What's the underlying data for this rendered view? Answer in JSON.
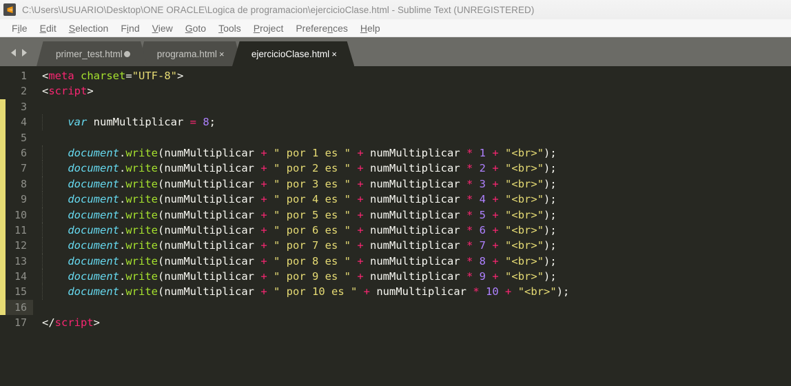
{
  "window": {
    "title": "C:\\Users\\USUARIO\\Desktop\\ONE ORACLE\\Logica de programacion\\ejercicioClase.html - Sublime Text (UNREGISTERED)",
    "logo_icon": "sublime-text-logo-icon"
  },
  "menubar": {
    "items": [
      {
        "label": "File",
        "pre": "F",
        "mn": "i",
        "post": "le"
      },
      {
        "label": "Edit",
        "pre": "",
        "mn": "E",
        "post": "dit"
      },
      {
        "label": "Selection",
        "pre": "",
        "mn": "S",
        "post": "election"
      },
      {
        "label": "Find",
        "pre": "F",
        "mn": "i",
        "post": "nd"
      },
      {
        "label": "View",
        "pre": "",
        "mn": "V",
        "post": "iew"
      },
      {
        "label": "Goto",
        "pre": "",
        "mn": "G",
        "post": "oto"
      },
      {
        "label": "Tools",
        "pre": "",
        "mn": "T",
        "post": "ools"
      },
      {
        "label": "Project",
        "pre": "",
        "mn": "P",
        "post": "roject"
      },
      {
        "label": "Preferences",
        "pre": "Prefere",
        "mn": "n",
        "post": "ces"
      },
      {
        "label": "Help",
        "pre": "",
        "mn": "H",
        "post": "elp"
      }
    ]
  },
  "tabbar": {
    "nav_back_icon": "chevron-left-icon",
    "nav_forward_icon": "chevron-forward-icon",
    "tabs": [
      {
        "label": "primer_test.html",
        "active": false,
        "indicator": "dirty-dot",
        "indicator_glyph": ""
      },
      {
        "label": "programa.html",
        "active": false,
        "indicator": "close-icon",
        "indicator_glyph": "×"
      },
      {
        "label": "ejercicioClase.html",
        "active": true,
        "indicator": "close-icon",
        "indicator_glyph": "×"
      }
    ]
  },
  "editor": {
    "theme": {
      "background": "#272822",
      "gutter_text": "#8f908a",
      "current_line_gutter": "#3a3a32",
      "modified_marker": "#e6db74",
      "plain": "#f8f8f2",
      "tag": "#f92672",
      "attribute": "#a6e22e",
      "string": "#e6db74",
      "keyword": "#66d9ef",
      "number": "#ae81ff",
      "operator": "#f92672"
    },
    "cursor_line": 16,
    "modified_lines": [
      3,
      16
    ],
    "lines": [
      {
        "n": 1,
        "indent": false,
        "tokens": [
          {
            "t": "plain",
            "v": "<"
          },
          {
            "t": "tag",
            "v": "meta"
          },
          {
            "t": "plain",
            "v": " "
          },
          {
            "t": "attr",
            "v": "charset"
          },
          {
            "t": "plain",
            "v": "="
          },
          {
            "t": "str",
            "v": "\"UTF-8\""
          },
          {
            "t": "plain",
            "v": ">"
          }
        ]
      },
      {
        "n": 2,
        "indent": false,
        "tokens": [
          {
            "t": "plain",
            "v": "<"
          },
          {
            "t": "tag",
            "v": "script"
          },
          {
            "t": "plain",
            "v": ">"
          }
        ]
      },
      {
        "n": 3,
        "indent": true,
        "tokens": []
      },
      {
        "n": 4,
        "indent": true,
        "tokens": [
          {
            "t": "plain",
            "v": "    "
          },
          {
            "t": "kw",
            "v": "var"
          },
          {
            "t": "plain",
            "v": " numMultiplicar "
          },
          {
            "t": "op",
            "v": "="
          },
          {
            "t": "plain",
            "v": " "
          },
          {
            "t": "num",
            "v": "8"
          },
          {
            "t": "plain",
            "v": ";"
          }
        ]
      },
      {
        "n": 5,
        "indent": true,
        "tokens": []
      },
      {
        "n": 6,
        "indent": true,
        "tokens": [
          {
            "t": "plain",
            "v": "    "
          },
          {
            "t": "kw",
            "v": "document"
          },
          {
            "t": "plain",
            "v": "."
          },
          {
            "t": "fn",
            "v": "write"
          },
          {
            "t": "plain",
            "v": "(numMultiplicar "
          },
          {
            "t": "op",
            "v": "+"
          },
          {
            "t": "plain",
            "v": " "
          },
          {
            "t": "str",
            "v": "\" por 1 es \""
          },
          {
            "t": "plain",
            "v": " "
          },
          {
            "t": "op",
            "v": "+"
          },
          {
            "t": "plain",
            "v": " numMultiplicar "
          },
          {
            "t": "op",
            "v": "*"
          },
          {
            "t": "plain",
            "v": " "
          },
          {
            "t": "num",
            "v": "1"
          },
          {
            "t": "plain",
            "v": " "
          },
          {
            "t": "op",
            "v": "+"
          },
          {
            "t": "plain",
            "v": " "
          },
          {
            "t": "str",
            "v": "\"<br>\""
          },
          {
            "t": "plain",
            "v": ");"
          }
        ]
      },
      {
        "n": 7,
        "indent": true,
        "tokens": [
          {
            "t": "plain",
            "v": "    "
          },
          {
            "t": "kw",
            "v": "document"
          },
          {
            "t": "plain",
            "v": "."
          },
          {
            "t": "fn",
            "v": "write"
          },
          {
            "t": "plain",
            "v": "(numMultiplicar "
          },
          {
            "t": "op",
            "v": "+"
          },
          {
            "t": "plain",
            "v": " "
          },
          {
            "t": "str",
            "v": "\" por 2 es \""
          },
          {
            "t": "plain",
            "v": " "
          },
          {
            "t": "op",
            "v": "+"
          },
          {
            "t": "plain",
            "v": " numMultiplicar "
          },
          {
            "t": "op",
            "v": "*"
          },
          {
            "t": "plain",
            "v": " "
          },
          {
            "t": "num",
            "v": "2"
          },
          {
            "t": "plain",
            "v": " "
          },
          {
            "t": "op",
            "v": "+"
          },
          {
            "t": "plain",
            "v": " "
          },
          {
            "t": "str",
            "v": "\"<br>\""
          },
          {
            "t": "plain",
            "v": ");"
          }
        ]
      },
      {
        "n": 8,
        "indent": true,
        "tokens": [
          {
            "t": "plain",
            "v": "    "
          },
          {
            "t": "kw",
            "v": "document"
          },
          {
            "t": "plain",
            "v": "."
          },
          {
            "t": "fn",
            "v": "write"
          },
          {
            "t": "plain",
            "v": "(numMultiplicar "
          },
          {
            "t": "op",
            "v": "+"
          },
          {
            "t": "plain",
            "v": " "
          },
          {
            "t": "str",
            "v": "\" por 3 es \""
          },
          {
            "t": "plain",
            "v": " "
          },
          {
            "t": "op",
            "v": "+"
          },
          {
            "t": "plain",
            "v": " numMultiplicar "
          },
          {
            "t": "op",
            "v": "*"
          },
          {
            "t": "plain",
            "v": " "
          },
          {
            "t": "num",
            "v": "3"
          },
          {
            "t": "plain",
            "v": " "
          },
          {
            "t": "op",
            "v": "+"
          },
          {
            "t": "plain",
            "v": " "
          },
          {
            "t": "str",
            "v": "\"<br>\""
          },
          {
            "t": "plain",
            "v": ");"
          }
        ]
      },
      {
        "n": 9,
        "indent": true,
        "tokens": [
          {
            "t": "plain",
            "v": "    "
          },
          {
            "t": "kw",
            "v": "document"
          },
          {
            "t": "plain",
            "v": "."
          },
          {
            "t": "fn",
            "v": "write"
          },
          {
            "t": "plain",
            "v": "(numMultiplicar "
          },
          {
            "t": "op",
            "v": "+"
          },
          {
            "t": "plain",
            "v": " "
          },
          {
            "t": "str",
            "v": "\" por 4 es \""
          },
          {
            "t": "plain",
            "v": " "
          },
          {
            "t": "op",
            "v": "+"
          },
          {
            "t": "plain",
            "v": " numMultiplicar "
          },
          {
            "t": "op",
            "v": "*"
          },
          {
            "t": "plain",
            "v": " "
          },
          {
            "t": "num",
            "v": "4"
          },
          {
            "t": "plain",
            "v": " "
          },
          {
            "t": "op",
            "v": "+"
          },
          {
            "t": "plain",
            "v": " "
          },
          {
            "t": "str",
            "v": "\"<br>\""
          },
          {
            "t": "plain",
            "v": ");"
          }
        ]
      },
      {
        "n": 10,
        "indent": true,
        "tokens": [
          {
            "t": "plain",
            "v": "    "
          },
          {
            "t": "kw",
            "v": "document"
          },
          {
            "t": "plain",
            "v": "."
          },
          {
            "t": "fn",
            "v": "write"
          },
          {
            "t": "plain",
            "v": "(numMultiplicar "
          },
          {
            "t": "op",
            "v": "+"
          },
          {
            "t": "plain",
            "v": " "
          },
          {
            "t": "str",
            "v": "\" por 5 es \""
          },
          {
            "t": "plain",
            "v": " "
          },
          {
            "t": "op",
            "v": "+"
          },
          {
            "t": "plain",
            "v": " numMultiplicar "
          },
          {
            "t": "op",
            "v": "*"
          },
          {
            "t": "plain",
            "v": " "
          },
          {
            "t": "num",
            "v": "5"
          },
          {
            "t": "plain",
            "v": " "
          },
          {
            "t": "op",
            "v": "+"
          },
          {
            "t": "plain",
            "v": " "
          },
          {
            "t": "str",
            "v": "\"<br>\""
          },
          {
            "t": "plain",
            "v": ");"
          }
        ]
      },
      {
        "n": 11,
        "indent": true,
        "tokens": [
          {
            "t": "plain",
            "v": "    "
          },
          {
            "t": "kw",
            "v": "document"
          },
          {
            "t": "plain",
            "v": "."
          },
          {
            "t": "fn",
            "v": "write"
          },
          {
            "t": "plain",
            "v": "(numMultiplicar "
          },
          {
            "t": "op",
            "v": "+"
          },
          {
            "t": "plain",
            "v": " "
          },
          {
            "t": "str",
            "v": "\" por 6 es \""
          },
          {
            "t": "plain",
            "v": " "
          },
          {
            "t": "op",
            "v": "+"
          },
          {
            "t": "plain",
            "v": " numMultiplicar "
          },
          {
            "t": "op",
            "v": "*"
          },
          {
            "t": "plain",
            "v": " "
          },
          {
            "t": "num",
            "v": "6"
          },
          {
            "t": "plain",
            "v": " "
          },
          {
            "t": "op",
            "v": "+"
          },
          {
            "t": "plain",
            "v": " "
          },
          {
            "t": "str",
            "v": "\"<br>\""
          },
          {
            "t": "plain",
            "v": ");"
          }
        ]
      },
      {
        "n": 12,
        "indent": true,
        "tokens": [
          {
            "t": "plain",
            "v": "    "
          },
          {
            "t": "kw",
            "v": "document"
          },
          {
            "t": "plain",
            "v": "."
          },
          {
            "t": "fn",
            "v": "write"
          },
          {
            "t": "plain",
            "v": "(numMultiplicar "
          },
          {
            "t": "op",
            "v": "+"
          },
          {
            "t": "plain",
            "v": " "
          },
          {
            "t": "str",
            "v": "\" por 7 es \""
          },
          {
            "t": "plain",
            "v": " "
          },
          {
            "t": "op",
            "v": "+"
          },
          {
            "t": "plain",
            "v": " numMultiplicar "
          },
          {
            "t": "op",
            "v": "*"
          },
          {
            "t": "plain",
            "v": " "
          },
          {
            "t": "num",
            "v": "7"
          },
          {
            "t": "plain",
            "v": " "
          },
          {
            "t": "op",
            "v": "+"
          },
          {
            "t": "plain",
            "v": " "
          },
          {
            "t": "str",
            "v": "\"<br>\""
          },
          {
            "t": "plain",
            "v": ");"
          }
        ]
      },
      {
        "n": 13,
        "indent": true,
        "tokens": [
          {
            "t": "plain",
            "v": "    "
          },
          {
            "t": "kw",
            "v": "document"
          },
          {
            "t": "plain",
            "v": "."
          },
          {
            "t": "fn",
            "v": "write"
          },
          {
            "t": "plain",
            "v": "(numMultiplicar "
          },
          {
            "t": "op",
            "v": "+"
          },
          {
            "t": "plain",
            "v": " "
          },
          {
            "t": "str",
            "v": "\" por 8 es \""
          },
          {
            "t": "plain",
            "v": " "
          },
          {
            "t": "op",
            "v": "+"
          },
          {
            "t": "plain",
            "v": " numMultiplicar "
          },
          {
            "t": "op",
            "v": "*"
          },
          {
            "t": "plain",
            "v": " "
          },
          {
            "t": "num",
            "v": "8"
          },
          {
            "t": "plain",
            "v": " "
          },
          {
            "t": "op",
            "v": "+"
          },
          {
            "t": "plain",
            "v": " "
          },
          {
            "t": "str",
            "v": "\"<br>\""
          },
          {
            "t": "plain",
            "v": ");"
          }
        ]
      },
      {
        "n": 14,
        "indent": true,
        "tokens": [
          {
            "t": "plain",
            "v": "    "
          },
          {
            "t": "kw",
            "v": "document"
          },
          {
            "t": "plain",
            "v": "."
          },
          {
            "t": "fn",
            "v": "write"
          },
          {
            "t": "plain",
            "v": "(numMultiplicar "
          },
          {
            "t": "op",
            "v": "+"
          },
          {
            "t": "plain",
            "v": " "
          },
          {
            "t": "str",
            "v": "\" por 9 es \""
          },
          {
            "t": "plain",
            "v": " "
          },
          {
            "t": "op",
            "v": "+"
          },
          {
            "t": "plain",
            "v": " numMultiplicar "
          },
          {
            "t": "op",
            "v": "*"
          },
          {
            "t": "plain",
            "v": " "
          },
          {
            "t": "num",
            "v": "9"
          },
          {
            "t": "plain",
            "v": " "
          },
          {
            "t": "op",
            "v": "+"
          },
          {
            "t": "plain",
            "v": " "
          },
          {
            "t": "str",
            "v": "\"<br>\""
          },
          {
            "t": "plain",
            "v": ");"
          }
        ]
      },
      {
        "n": 15,
        "indent": true,
        "tokens": [
          {
            "t": "plain",
            "v": "    "
          },
          {
            "t": "kw",
            "v": "document"
          },
          {
            "t": "plain",
            "v": "."
          },
          {
            "t": "fn",
            "v": "write"
          },
          {
            "t": "plain",
            "v": "(numMultiplicar "
          },
          {
            "t": "op",
            "v": "+"
          },
          {
            "t": "plain",
            "v": " "
          },
          {
            "t": "str",
            "v": "\" por 10 es \""
          },
          {
            "t": "plain",
            "v": " "
          },
          {
            "t": "op",
            "v": "+"
          },
          {
            "t": "plain",
            "v": " numMultiplicar "
          },
          {
            "t": "op",
            "v": "*"
          },
          {
            "t": "plain",
            "v": " "
          },
          {
            "t": "num",
            "v": "10"
          },
          {
            "t": "plain",
            "v": " "
          },
          {
            "t": "op",
            "v": "+"
          },
          {
            "t": "plain",
            "v": " "
          },
          {
            "t": "str",
            "v": "\"<br>\""
          },
          {
            "t": "plain",
            "v": ");"
          }
        ]
      },
      {
        "n": 16,
        "indent": false,
        "tokens": []
      },
      {
        "n": 17,
        "indent": false,
        "tokens": [
          {
            "t": "plain",
            "v": "</"
          },
          {
            "t": "tag",
            "v": "script"
          },
          {
            "t": "plain",
            "v": ">"
          }
        ]
      }
    ]
  }
}
